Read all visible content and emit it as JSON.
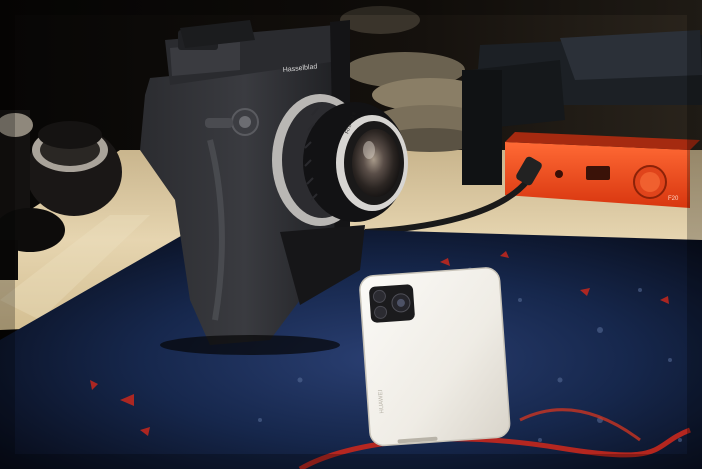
{
  "photo": {
    "camera_brand_text": "Hasselblad",
    "phone_brand_text": "HUAWEI",
    "lens_marking_text": "F0.8  1:2.8",
    "dac_model_text": "F20"
  },
  "colors": {
    "background": "#0a0807",
    "wood_surface": "#d9c79f",
    "camera_body": "#1e1f22",
    "lens_barrel": "#121214",
    "phone_body": "#f0eee8",
    "dac_orange": "#f04b1d",
    "mat_blue": "#10203e",
    "mat_red_accent": "#c7281d",
    "shelf_dark": "#15181b"
  }
}
